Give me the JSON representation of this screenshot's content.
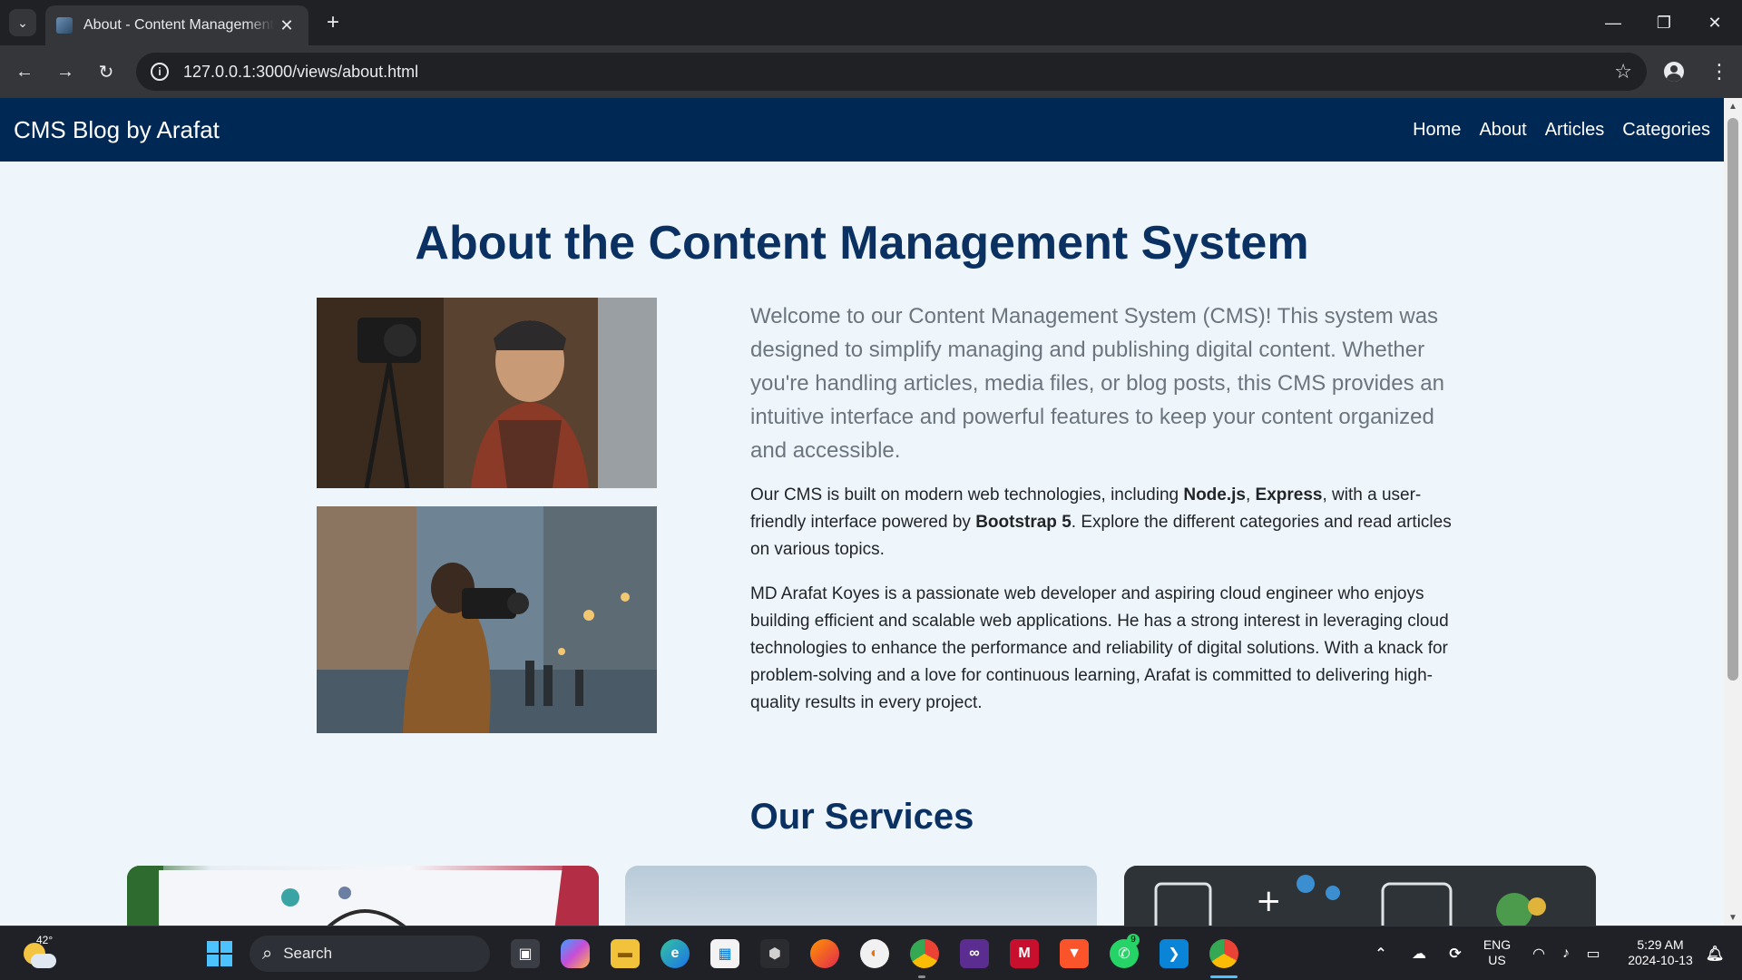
{
  "browser": {
    "tab_title": "About - Content Management System",
    "url": "127.0.0.1:3000/views/about.html",
    "new_tab_symbol": "+",
    "close_symbol": "✕"
  },
  "site": {
    "brand": "CMS Blog by Arafat",
    "nav": [
      {
        "label": "Home"
      },
      {
        "label": "About"
      },
      {
        "label": "Articles"
      },
      {
        "label": "Categories"
      }
    ],
    "title": "About the Content Management System",
    "lead": "Welcome to our Content Management System (CMS)! This system was designed to simplify managing and publishing digital content. Whether you're handling articles, media files, or blog posts, this CMS provides an intuitive interface and powerful features to keep your content organized and accessible.",
    "para2": {
      "p1": "Our CMS is built on modern web technologies, including ",
      "b1": "Node.js",
      "p2": ", ",
      "b2": "Express",
      "p3": ", with a user-friendly interface powered by ",
      "b3": "Bootstrap 5",
      "p4": ". Explore the different categories and read articles on various topics."
    },
    "para3": "MD Arafat Koyes is a passionate web developer and aspiring cloud engineer who enjoys building efficient and scalable web applications. He has a strong interest in leveraging cloud technologies to enhance the performance and reliability of digital solutions. With a knack for problem-solving and a love for continuous learning, Arafat is committed to delivering high-quality results in every project.",
    "services_title": "Our Services"
  },
  "taskbar": {
    "temperature": "42°",
    "search_label": "Search",
    "language": "ENG",
    "region": "US",
    "time": "5:29 AM",
    "date": "2024-10-13",
    "whatsapp_badge": "9"
  },
  "colors": {
    "navbar": "#002855",
    "title": "#0a3161",
    "page_bg": "#eef6fb"
  }
}
